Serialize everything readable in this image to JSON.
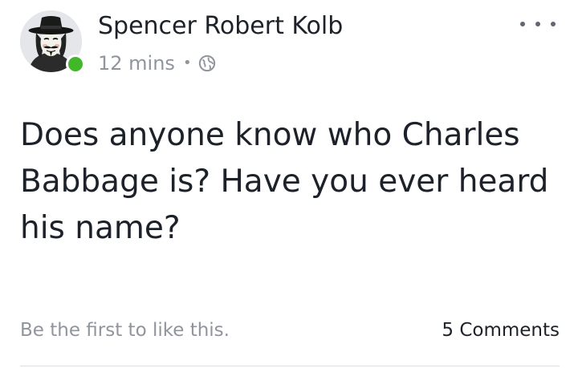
{
  "post": {
    "author": "Spencer Robert Kolb",
    "time": "12 mins",
    "separator": "•",
    "audience_icon": "globe-icon",
    "text": "Does anyone know who Charles Babbage is? Have you ever heard his name?",
    "more_icon": "ellipsis-icon",
    "online_status_color": "#42b72a"
  },
  "footer": {
    "likes_text": "Be the first to like this.",
    "comments_text": "5 Comments"
  },
  "colors": {
    "primary_text": "#1d2129",
    "secondary_text": "#90949c",
    "divider": "#dadde1"
  }
}
